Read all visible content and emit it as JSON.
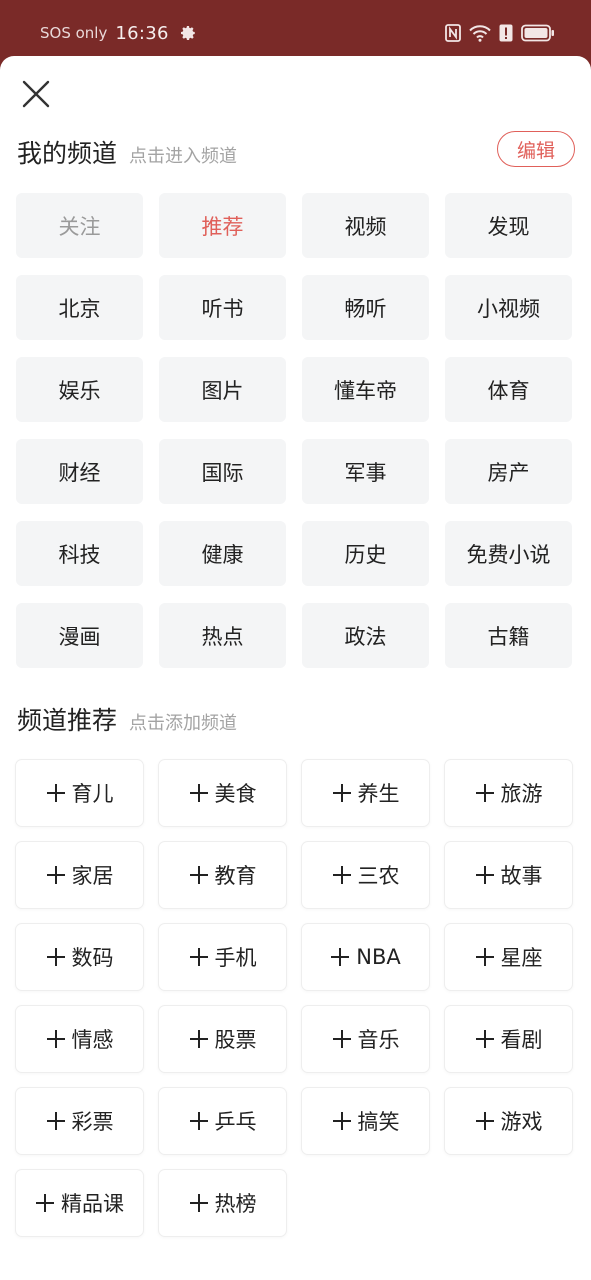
{
  "status_bar": {
    "carrier": "SOS only",
    "time": "16:36",
    "icons": [
      "gear-icon",
      "nfc-icon",
      "wifi-icon",
      "alert-icon",
      "battery-icon"
    ]
  },
  "colors": {
    "header_bg": "#7a2a28",
    "accent": "#e0605a",
    "chip_bg": "#f4f5f6"
  },
  "my_channels": {
    "title": "我的频道",
    "hint": "点击进入频道",
    "edit_label": "编辑",
    "items": [
      {
        "label": "关注"
      },
      {
        "label": "推荐"
      },
      {
        "label": "视频"
      },
      {
        "label": "发现"
      },
      {
        "label": "北京"
      },
      {
        "label": "听书"
      },
      {
        "label": "畅听"
      },
      {
        "label": "小视频"
      },
      {
        "label": "娱乐"
      },
      {
        "label": "图片"
      },
      {
        "label": "懂车帝"
      },
      {
        "label": "体育"
      },
      {
        "label": "财经"
      },
      {
        "label": "国际"
      },
      {
        "label": "军事"
      },
      {
        "label": "房产"
      },
      {
        "label": "科技"
      },
      {
        "label": "健康"
      },
      {
        "label": "历史"
      },
      {
        "label": "免费小说"
      },
      {
        "label": "漫画"
      },
      {
        "label": "热点"
      },
      {
        "label": "政法"
      },
      {
        "label": "古籍"
      }
    ]
  },
  "recommended": {
    "title": "频道推荐",
    "hint": "点击添加频道",
    "items": [
      {
        "label": "育儿"
      },
      {
        "label": "美食"
      },
      {
        "label": "养生"
      },
      {
        "label": "旅游"
      },
      {
        "label": "家居"
      },
      {
        "label": "教育"
      },
      {
        "label": "三农"
      },
      {
        "label": "故事"
      },
      {
        "label": "数码"
      },
      {
        "label": "手机"
      },
      {
        "label": "NBA"
      },
      {
        "label": "星座"
      },
      {
        "label": "情感"
      },
      {
        "label": "股票"
      },
      {
        "label": "音乐"
      },
      {
        "label": "看剧"
      },
      {
        "label": "彩票"
      },
      {
        "label": "乒乓"
      },
      {
        "label": "搞笑"
      },
      {
        "label": "游戏"
      },
      {
        "label": "精品课"
      },
      {
        "label": "热榜"
      }
    ]
  }
}
